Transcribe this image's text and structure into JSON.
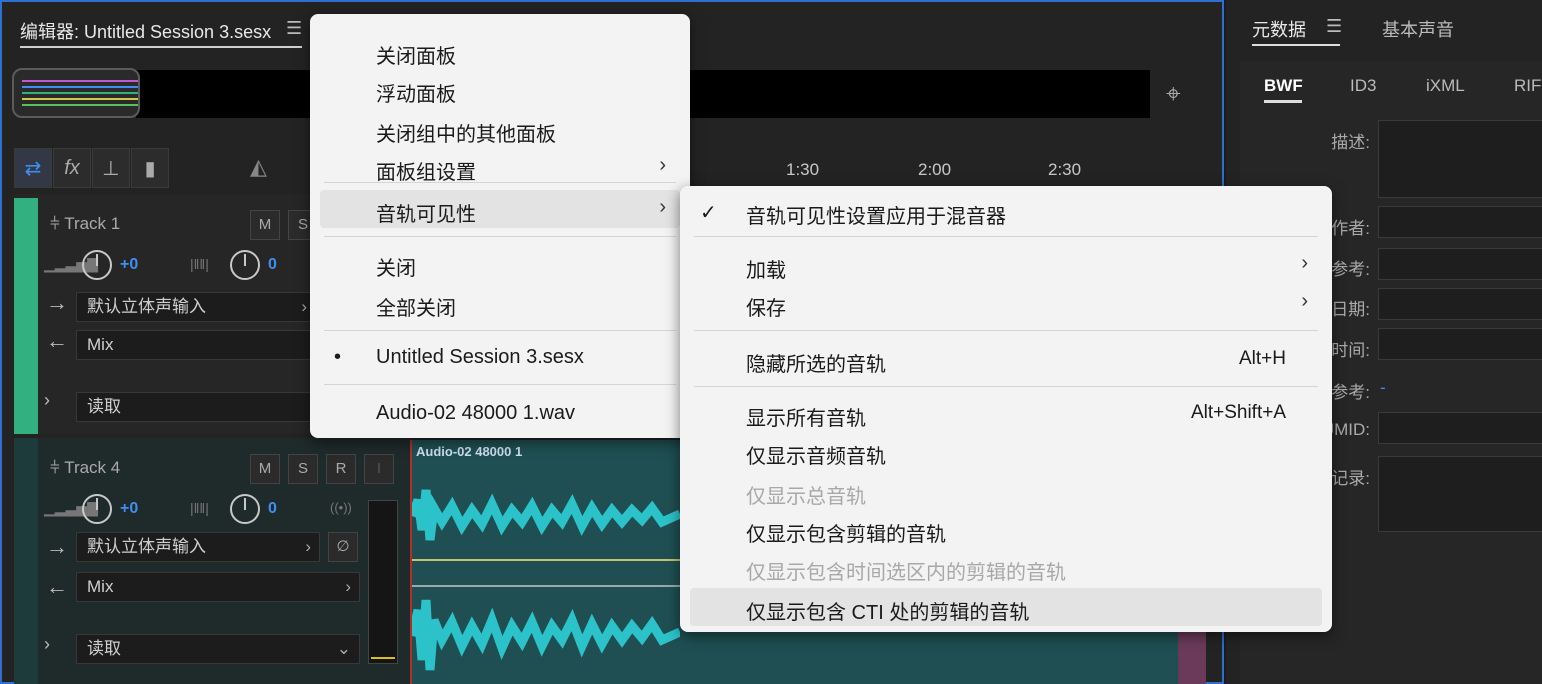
{
  "editor": {
    "tab_title": "编辑器: Untitled Session 3.sesx",
    "ruler_ticks": [
      "1:30",
      "2:00",
      "2:30"
    ],
    "track1": {
      "name": "Track 1",
      "mute": "M",
      "solo": "S",
      "volume": "+0",
      "pan": "0",
      "input": "默认立体声输入",
      "output": "Mix",
      "automation": "读取"
    },
    "track4": {
      "name": "Track 4",
      "mute": "M",
      "solo": "S",
      "record": "R",
      "input_monitor": "I",
      "volume": "+0",
      "pan": "0",
      "input": "默认立体声输入",
      "output": "Mix",
      "automation": "读取",
      "clip_name": "Audio-02 48000 1"
    }
  },
  "metadata": {
    "tab_active": "元数据",
    "tab_other": "基本声音",
    "sub_tabs": [
      "BWF",
      "ID3",
      "iXML",
      "RIFF"
    ],
    "labels": [
      "描述:",
      "作者:",
      "参考:",
      "日期:",
      "时间:",
      "参考:",
      "UMID:",
      "记录:"
    ],
    "ref_value": "-"
  },
  "menu1": {
    "items": [
      {
        "label": "关闭面板"
      },
      {
        "label": "浮动面板"
      },
      {
        "label": "关闭组中的其他面板"
      },
      {
        "label": "面板组设置",
        "submenu": true
      },
      {
        "label": "音轨可见性",
        "submenu": true,
        "highlighted": true
      },
      {
        "label": "关闭"
      },
      {
        "label": "全部关闭"
      },
      {
        "label": "Untitled Session 3.sesx",
        "bullet": "•"
      },
      {
        "label": "Audio-02 48000 1.wav"
      }
    ]
  },
  "menu2": {
    "items": [
      {
        "label": "音轨可见性设置应用于混音器",
        "check": "✓"
      },
      {
        "label": "加载",
        "submenu": true
      },
      {
        "label": "保存",
        "submenu": true
      },
      {
        "label": "隐藏所选的音轨",
        "shortcut": "Alt+H"
      },
      {
        "label": "显示所有音轨",
        "shortcut": "Alt+Shift+A"
      },
      {
        "label": "仅显示音频音轨"
      },
      {
        "label": "仅显示总音轨",
        "disabled": true
      },
      {
        "label": "仅显示包含剪辑的音轨"
      },
      {
        "label": "仅显示包含时间选区内的剪辑的音轨",
        "disabled": true
      },
      {
        "label": "仅显示包含 CTI 处的剪辑的音轨",
        "highlighted": true
      }
    ]
  },
  "colors": {
    "accent": "#3f8ef0",
    "track1_color": "#33b07f",
    "waveform": "#2bc3c9",
    "panel_border": "#2f6fd0"
  },
  "icons": {
    "chevron": "›",
    "zoom": "⌖"
  }
}
